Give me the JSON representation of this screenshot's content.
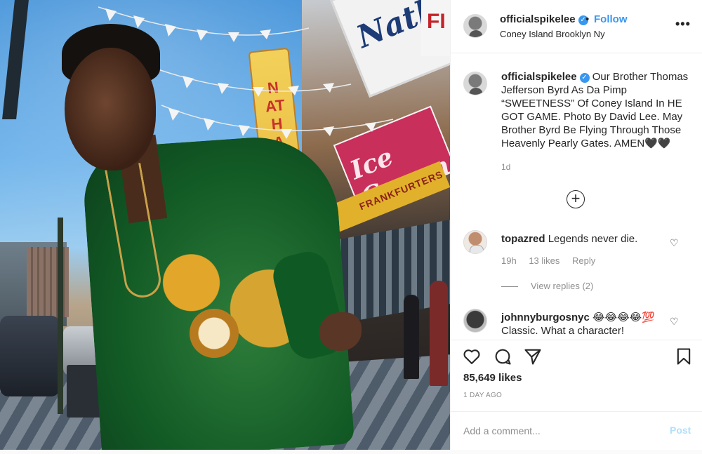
{
  "post": {
    "username": "officialspikelee",
    "follow_label": "Follow",
    "dot": "•",
    "location": "Coney Island Brooklyn Ny",
    "more_label": "•••"
  },
  "photo_signs": {
    "nathans": "Nathan's",
    "red": "FI",
    "cream": "Ice Cream",
    "frankfurters": "FRANKFURTERS",
    "tower": "NATHANS"
  },
  "caption": {
    "username": "officialspikelee",
    "text": "Our Brother Thomas Jefferson Byrd As Da Pimp “SWEETNESS” Of Coney Island In HE GOT GAME. Photo By David Lee. May Brother Byrd Be Flying Through Those Heavenly Pearly Gates. AMEN🖤🖤",
    "age": "1d"
  },
  "load_more_symbol": "+",
  "comments": [
    {
      "username": "topazred",
      "text": "Legends never die.",
      "time": "19h",
      "likes": "13 likes",
      "reply": "Reply",
      "view_replies": "View replies (2)"
    },
    {
      "username": "johnnyburgosnyc",
      "emoji": "😂😂😂😂💯",
      "text": "Classic. What a character!"
    }
  ],
  "actions": {
    "likes": "85,649 likes",
    "time_ago": "1 DAY AGO"
  },
  "add_comment": {
    "placeholder": "Add a comment...",
    "post_label": "Post"
  },
  "icons": [
    "verified-icon",
    "more-icon",
    "load-more-icon",
    "heart-icon",
    "comment-icon",
    "share-icon",
    "bookmark-icon"
  ],
  "colors": {
    "accent": "#3897f0",
    "post_disabled": "#b2dffc",
    "muted": "#8e8e8e",
    "text": "#262626"
  }
}
